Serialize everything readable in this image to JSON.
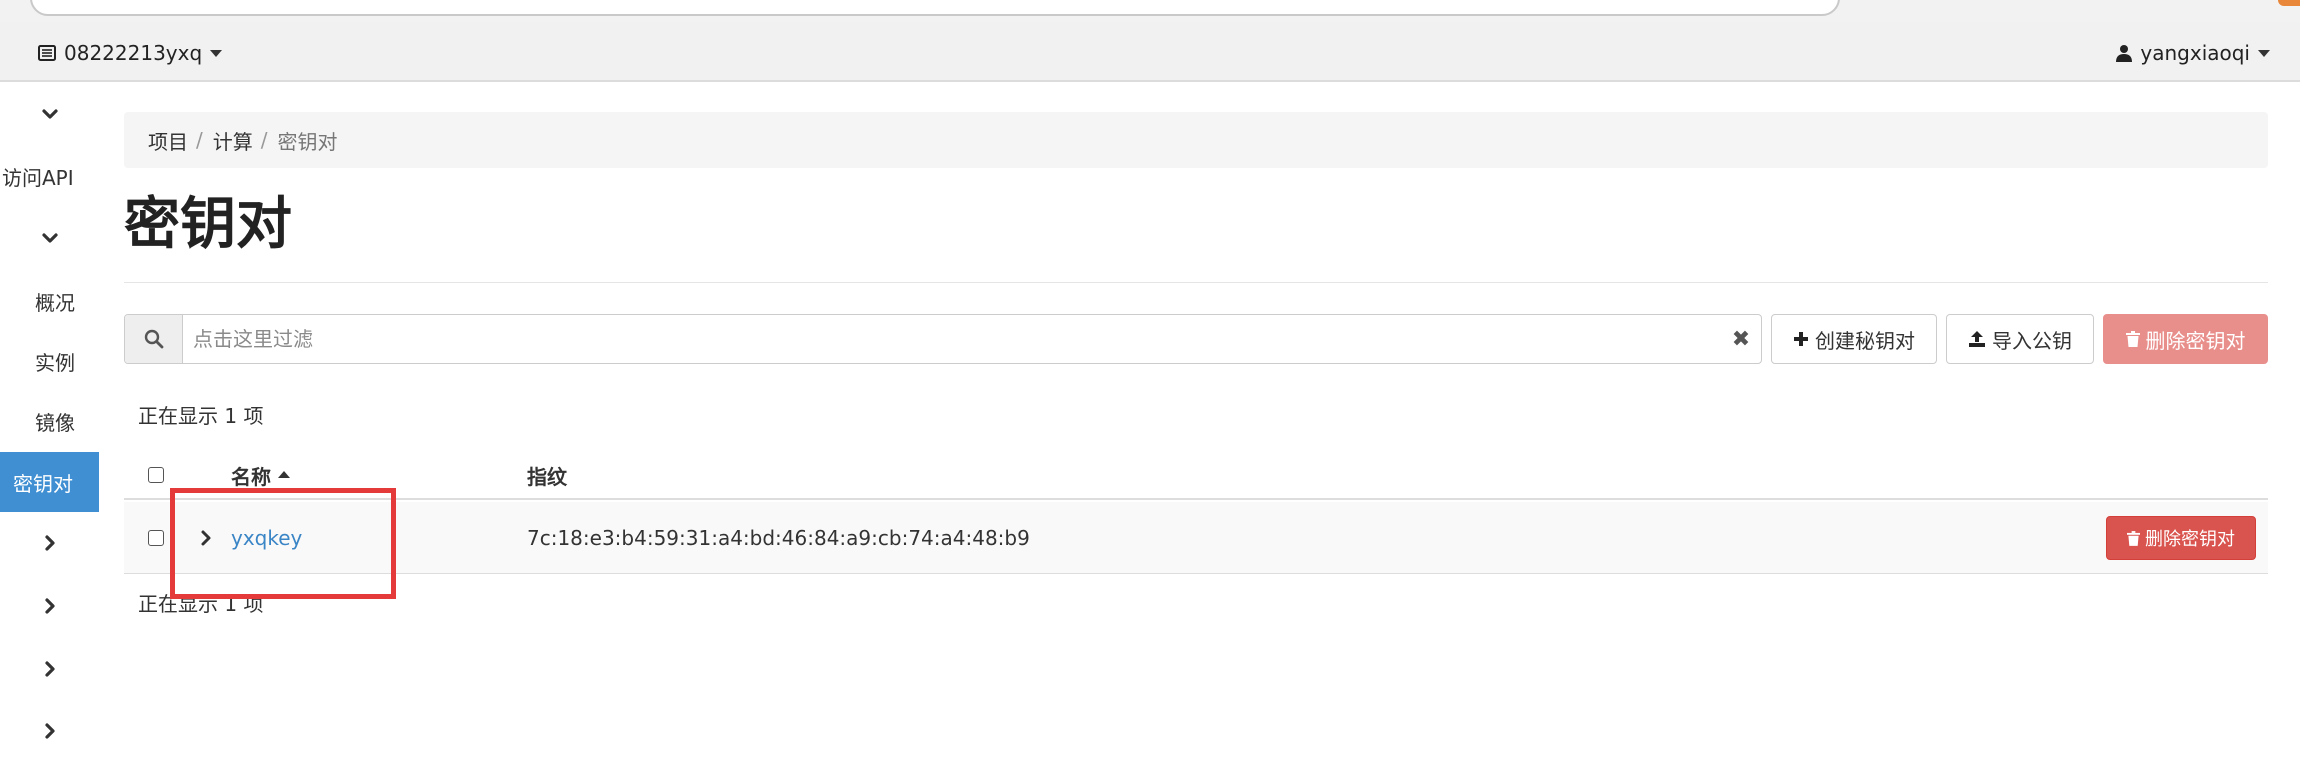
{
  "navbar": {
    "project_name": "08222213yxq",
    "user_name": "yangxiaoqi"
  },
  "sidebar": {
    "items": [
      {
        "label": "",
        "icon": "chevron-down-icon"
      },
      {
        "label": "访问API",
        "icon": ""
      },
      {
        "label": "",
        "icon": "chevron-down-icon"
      },
      {
        "label": "概况",
        "icon": ""
      },
      {
        "label": "实例",
        "icon": ""
      },
      {
        "label": "镜像",
        "icon": ""
      },
      {
        "label": "密钥对",
        "icon": "",
        "active": true
      },
      {
        "label": "",
        "icon": "chevron-right-icon"
      },
      {
        "label": "",
        "icon": "chevron-right-icon"
      },
      {
        "label": "",
        "icon": "chevron-right-icon"
      },
      {
        "label": "",
        "icon": "chevron-right-icon"
      }
    ]
  },
  "breadcrumb": {
    "items": [
      "项目",
      "计算",
      "密钥对"
    ],
    "separator": "/"
  },
  "page": {
    "title": "密钥对"
  },
  "filter": {
    "placeholder": "点击这里过滤",
    "value": "",
    "clear_glyph": "✖"
  },
  "actions": {
    "create_label": "创建秘钥对",
    "import_label": "导入公钥",
    "delete_label": "删除密钥对"
  },
  "table": {
    "count_text": "正在显示 1 项",
    "columns": [
      "名称",
      "指纹"
    ],
    "sort_column": "名称",
    "rows": [
      {
        "name": "yxqkey",
        "fingerprint": "7c:18:e3:b4:59:31:a4:bd:46:84:a9:cb:74:a4:48:b9",
        "action_label": "删除密钥对"
      }
    ]
  },
  "colors": {
    "accent": "#3f8fd2",
    "danger": "#d9534f",
    "danger_disabled": "#e88f8c",
    "link": "#3a85c6",
    "annotation": "#e53a3a"
  }
}
